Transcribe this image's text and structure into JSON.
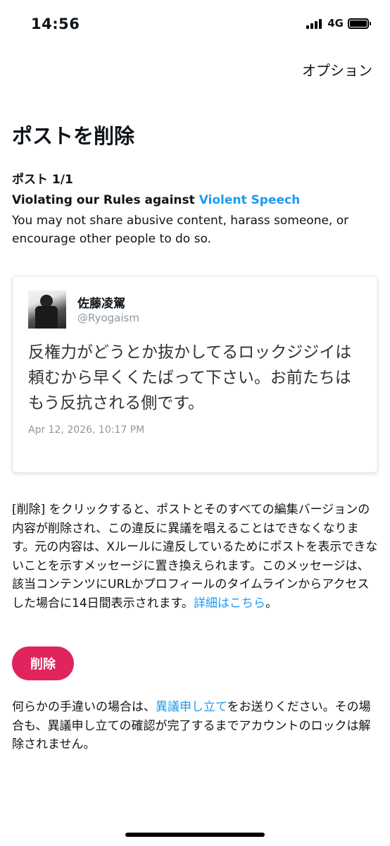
{
  "status_bar": {
    "time": "14:56",
    "network": "4G"
  },
  "header": {
    "options_label": "オプション"
  },
  "page": {
    "title": "ポストを削除",
    "post_count": "ポスト 1/1"
  },
  "violation": {
    "title_prefix": "Violating our Rules against ",
    "title_link": "Violent Speech",
    "description": "You may not share abusive content, harass someone, or encourage other people to do so."
  },
  "tweet": {
    "author_name": "佐藤凌駕",
    "author_handle": "@Ryogaism",
    "text": "反権力がどうとか抜かしてるロックジジイは頼むから早くくたばって下さい。お前たちはもう反抗される側です。",
    "date": "Apr 12, 2026, 10:17 PM"
  },
  "info": {
    "text": "[削除] をクリックすると、ポストとそのすべての編集バージョンの内容が削除され、この違反に異議を唱えることはできなくなります。元の内容は、Xルールに違反しているためにポストを表示できないことを示すメッセージに置き換えられます。このメッセージは、該当コンテンツにURLかプロフィールのタイムラインからアクセスした場合に14日間表示されます。",
    "link": "詳細はこちら",
    "suffix": "。"
  },
  "delete_button": {
    "label": "削除",
    "color": "#e0245e"
  },
  "appeal": {
    "prefix": "何らかの手違いの場合は、",
    "link": "異議申し立て",
    "suffix": "をお送りください。その場合も、異議申し立ての確認が完了するまでアカウントのロックは解除されません。"
  },
  "colors": {
    "link": "#1d9bf0",
    "handle": "#8b98a5"
  }
}
